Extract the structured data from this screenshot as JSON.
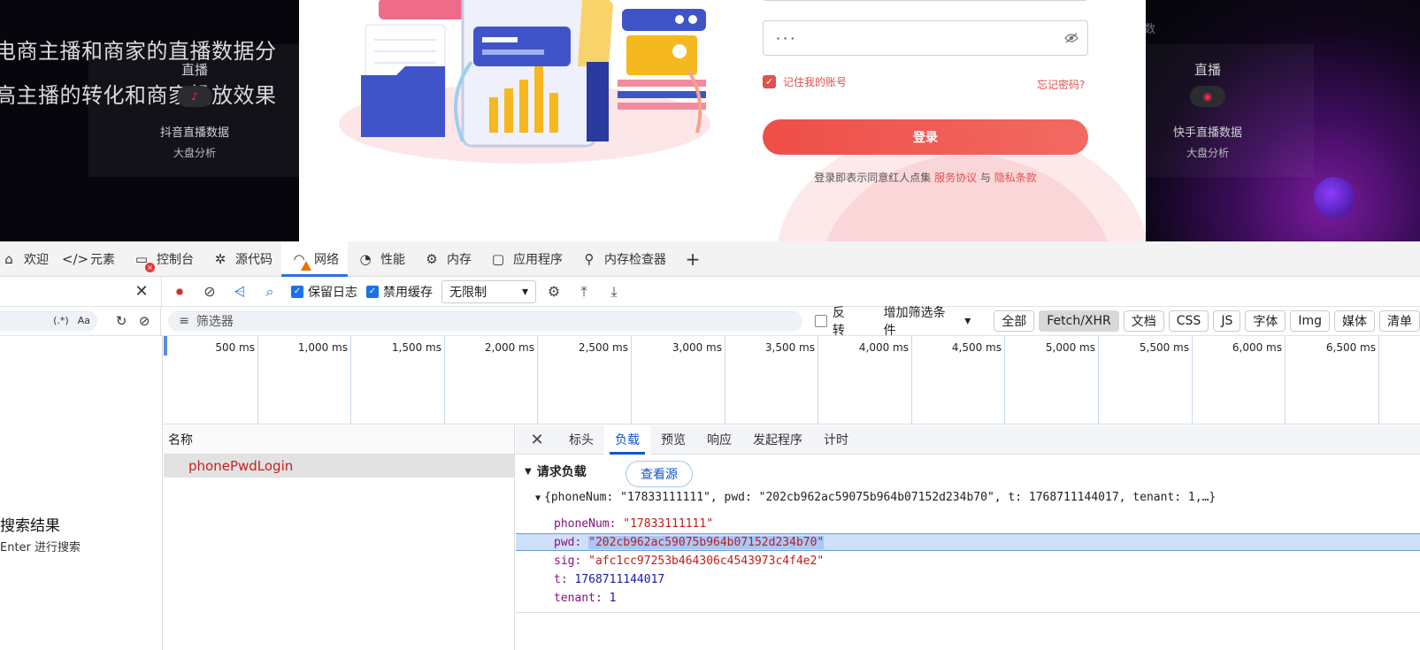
{
  "page": {
    "headline1": "电商主播和商家的直播数据分",
    "headline2": "高主播的转化和商家投放效果",
    "left_card": {
      "live": "直播",
      "line1": "抖音直播数据",
      "line2": "大盘分析"
    },
    "right_card": {
      "live": "直播",
      "line1": "快手直播数据",
      "line2": "大盘分析"
    },
    "right_top_text": "数"
  },
  "login": {
    "password_value": "···",
    "remember_label": "记住我的账号",
    "forgot_label": "忘记密码?",
    "login_button": "登录",
    "agree_prefix": "登录即表示同意红人点集 ",
    "service_link": "服务协议",
    "and_text": " 与 ",
    "privacy_link": "隐私条款"
  },
  "devtools": {
    "tabs": [
      {
        "label": "欢迎",
        "icon": "home-icon"
      },
      {
        "label": "元素",
        "icon": "code-icon"
      },
      {
        "label": "控制台",
        "icon": "console-icon"
      },
      {
        "label": "源代码",
        "icon": "bug-icon"
      },
      {
        "label": "网络",
        "icon": "wifi-icon"
      },
      {
        "label": "性能",
        "icon": "gauge-icon"
      },
      {
        "label": "内存",
        "icon": "chip-icon"
      },
      {
        "label": "应用程序",
        "icon": "window-icon"
      },
      {
        "label": "内存检查器",
        "icon": "memory-inspector-icon"
      }
    ],
    "toolbar": {
      "preserve_log": "保留日志",
      "disable_cache": "禁用缓存",
      "throttle": "无限制"
    },
    "filter": {
      "placeholder": "筛选器",
      "invert": "反转",
      "add_filter": "增加筛选条件",
      "regex": "(.*)",
      "case": "Aa",
      "chips": [
        "全部",
        "Fetch/XHR",
        "文档",
        "CSS",
        "JS",
        "字体",
        "Img",
        "媒体",
        "清单"
      ],
      "selected_chip": "Fetch/XHR"
    },
    "timeline_ticks": [
      "500 ms",
      "1,000 ms",
      "1,500 ms",
      "2,000 ms",
      "2,500 ms",
      "3,000 ms",
      "3,500 ms",
      "4,000 ms",
      "4,500 ms",
      "5,000 ms",
      "5,500 ms",
      "6,000 ms",
      "6,500 ms"
    ],
    "search": {
      "no_results": "搜索结果",
      "hint": "Enter 进行搜索"
    },
    "request_list": {
      "header": "名称",
      "rows": [
        "phonePwdLogin"
      ]
    },
    "detail_tabs": [
      "标头",
      "负载",
      "预览",
      "响应",
      "发起程序",
      "计时"
    ],
    "active_detail_tab": "负载",
    "payload": {
      "section_title": "请求负载",
      "view_source": "查看源",
      "summary": "{phoneNum: \"17833111111\", pwd: \"202cb962ac59075b964b07152d234b70\", t: 1768711144017, tenant: 1,…}",
      "fields": [
        {
          "key": "phoneNum",
          "value": "\"17833111111\"",
          "type": "string"
        },
        {
          "key": "pwd",
          "value": "\"202cb962ac59075b964b07152d234b70\"",
          "type": "string"
        },
        {
          "key": "sig",
          "value": "\"afc1cc97253b464306c4543973c4f4e2\"",
          "type": "string"
        },
        {
          "key": "t",
          "value": "1768711144017",
          "type": "number"
        },
        {
          "key": "tenant",
          "value": "1",
          "type": "number"
        }
      ]
    }
  }
}
